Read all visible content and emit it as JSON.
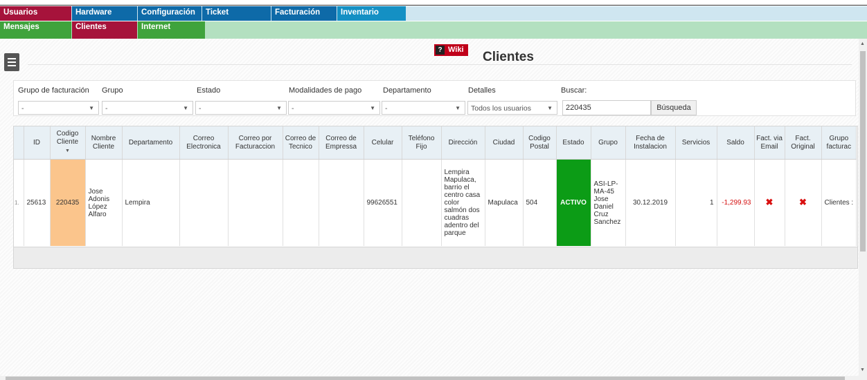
{
  "menu": {
    "row1": [
      "Usuarios",
      "Hardware",
      "Configuración",
      "Ticket",
      "Facturación",
      "Inventario"
    ],
    "row2": [
      "Mensajes",
      "Clientes",
      "Internet"
    ]
  },
  "header": {
    "wiki_q": "?",
    "wiki_label": "Wiki",
    "title": "Clientes"
  },
  "filters": {
    "labels": [
      "Grupo de facturación",
      "Grupo",
      "Estado",
      "Modalidades de pago",
      "Departamento",
      "Detalles",
      "Buscar:"
    ],
    "selects": [
      "-",
      "-",
      "-",
      "-",
      "-",
      "Todos los usuarios"
    ],
    "search_value": "220435",
    "search_button": "Búsqueda"
  },
  "table": {
    "columns": [
      "",
      "ID",
      "Codigo Cliente",
      "Nombre Cliente",
      "Departamento",
      "Correo Electronica",
      "Correo por Facturaccion",
      "Correo de Tecnico",
      "Correo de Empressa",
      "Celular",
      "Teléfono Fijo",
      "Dirección",
      "Ciudad",
      "Codigo Postal",
      "Estado",
      "Grupo",
      "Fecha de Instalacion",
      "Servicios",
      "Saldo",
      "Fact. via Email",
      "Fact. Original",
      "Grupo facturac"
    ],
    "row": {
      "index": "1.",
      "id": "25613",
      "codigo": "220435",
      "nombre": "Jose Adonis López Alfaro",
      "departamento": "Lempira",
      "correo_electronica": "",
      "correo_facturacion": "",
      "correo_tecnico": "",
      "correo_empresa": "",
      "celular": "99626551",
      "telefono": "",
      "direccion": "Lempira Mapulaca, barrio el centro casa color salmón dos cuadras adentro del parque",
      "ciudad": "Mapulaca",
      "postal": "504",
      "estado": "ACTIVO",
      "grupo": "ASI-LP-MA-45 Jose Daniel Cruz Sanchez",
      "fecha": "30.12.2019",
      "servicios": "1",
      "saldo": "-1,299.93",
      "fact_email": "✖",
      "fact_original": "✖",
      "grupo_fact": "Clientes :"
    }
  }
}
